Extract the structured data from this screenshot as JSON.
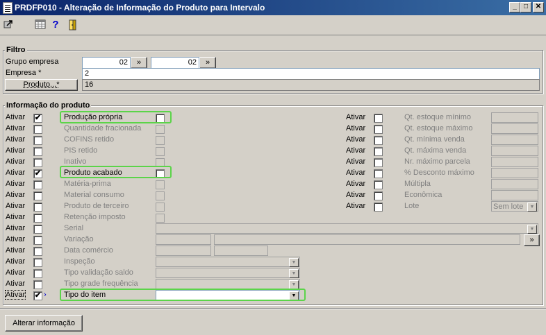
{
  "window": {
    "title": "PRDFP010 - Alteração de Informação do Produto para Intervalo",
    "minimize": "_",
    "maximize": "□",
    "close": "✕"
  },
  "toolbar": {
    "icons": [
      "export-icon",
      "grid-icon",
      "help-icon",
      "exit-door-icon"
    ],
    "help_glyph": "?"
  },
  "filter": {
    "group_label": "Filtro",
    "grupo_empresa_label": "Grupo empresa",
    "grupo_from": "02",
    "grupo_to": "02",
    "lookup_glyph": "»",
    "empresa_label": "Empresa *",
    "empresa_value": "2",
    "produto_button": "Produto...*",
    "produto_value": "16"
  },
  "info": {
    "group_label": "Informação do produto",
    "ativar": "Ativar",
    "check_glyph": "✔",
    "dropdown_glyph": "▼",
    "left_rows": [
      {
        "label": "Produção própria",
        "checked": true,
        "enabled": true
      },
      {
        "label": "Quantidade fracionada",
        "checked": false,
        "enabled": false
      },
      {
        "label": "COFINS retido",
        "checked": false,
        "enabled": false
      },
      {
        "label": "PIS retido",
        "checked": false,
        "enabled": false
      },
      {
        "label": "Inativo",
        "checked": false,
        "enabled": false
      },
      {
        "label": "Produto acabado",
        "checked": true,
        "enabled": true
      },
      {
        "label": "Matéria-prima",
        "checked": false,
        "enabled": false
      },
      {
        "label": "Material consumo",
        "checked": false,
        "enabled": false
      },
      {
        "label": "Produto de terceiro",
        "checked": false,
        "enabled": false
      },
      {
        "label": "Retenção imposto",
        "checked": false,
        "enabled": false
      }
    ],
    "right_rows": [
      {
        "label": "Qt. estoque mínimo"
      },
      {
        "label": "Qt. estoque máximo"
      },
      {
        "label": "Qt. mínima venda"
      },
      {
        "label": "Qt. máxima venda"
      },
      {
        "label": "Nr. máximo parcela"
      },
      {
        "label": "% Desconto máximo"
      },
      {
        "label": "Múltipla"
      },
      {
        "label": "Econômica"
      },
      {
        "label": "Lote",
        "value": "Sem lote"
      }
    ],
    "serial_label": "Serial",
    "variacao_label": "Variação",
    "data_comercio_label": "Data comércio",
    "inspecao_label": "Inspeção",
    "tipo_validacao_label": "Tipo validação saldo",
    "tipo_grade_label": "Tipo grade frequência",
    "tipo_item_label": "Tipo do item",
    "variacao_lookup": "»",
    "caret": "›"
  },
  "footer": {
    "alterar_button": "Alterar informação"
  }
}
